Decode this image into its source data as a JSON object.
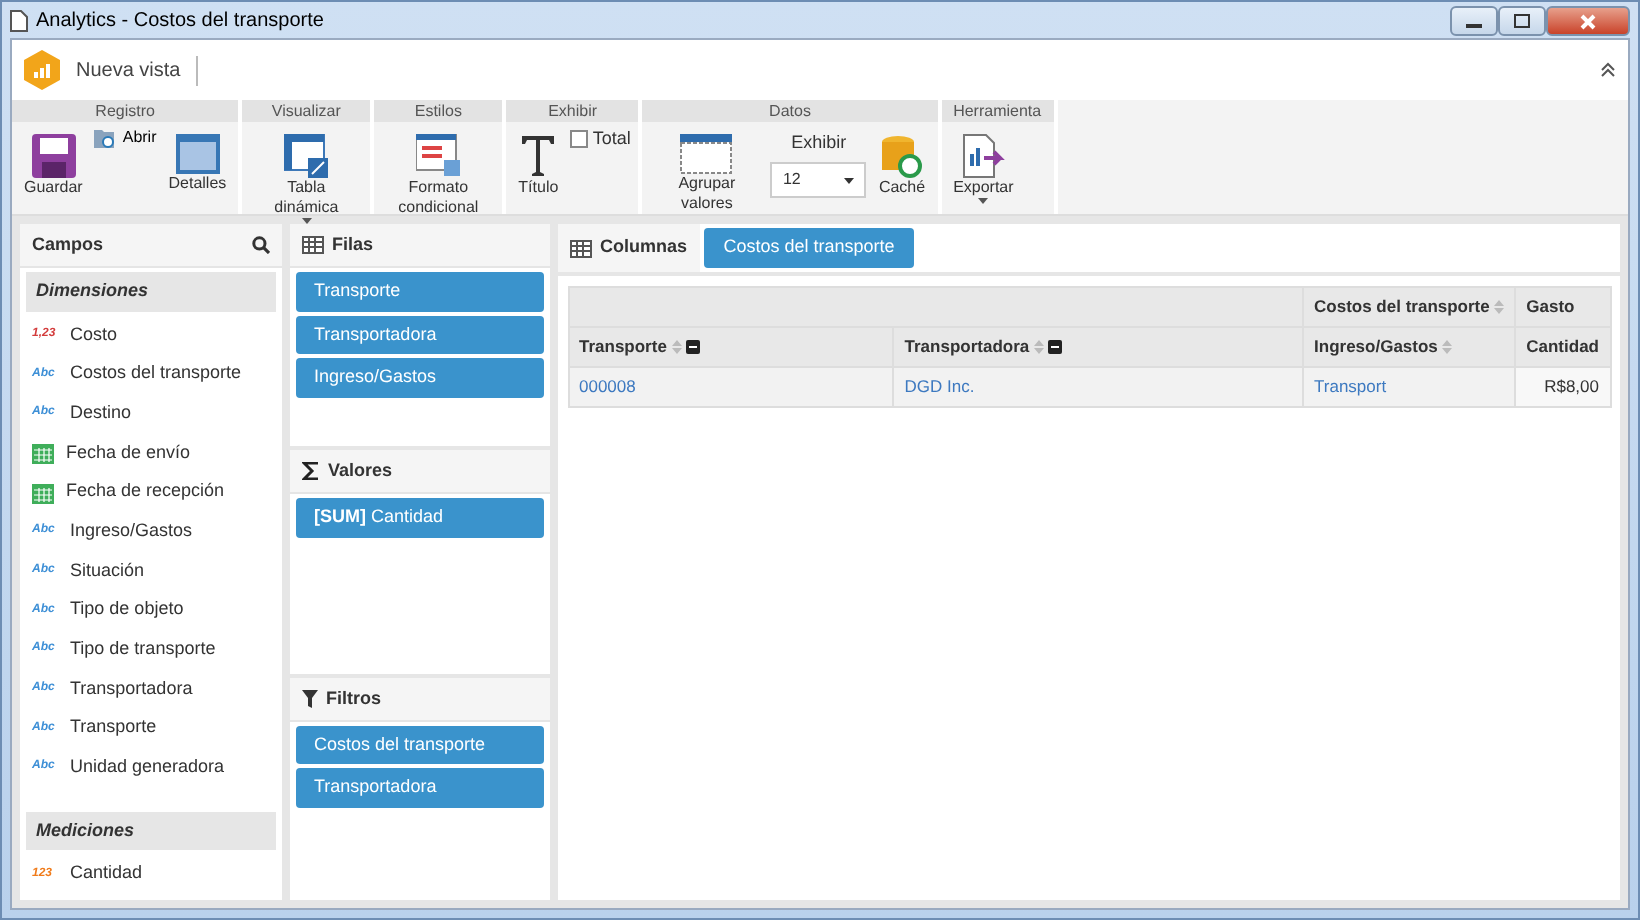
{
  "window": {
    "title": "Analytics - Costos del transporte"
  },
  "header": {
    "view_title": "Nueva vista"
  },
  "ribbon": [
    {
      "group": "Registro",
      "items": [
        {
          "kind": "big",
          "label": "Guardar"
        },
        {
          "kind": "small",
          "label": "Abrir"
        },
        {
          "kind": "big",
          "label": "Detalles"
        }
      ]
    },
    {
      "group": "Visualizar",
      "items": [
        {
          "kind": "big",
          "label": "Tabla dinámica",
          "dropdown": true
        }
      ]
    },
    {
      "group": "Estilos",
      "items": [
        {
          "kind": "big",
          "label": "Formato condicional"
        }
      ]
    },
    {
      "group": "Exhibir",
      "items": [
        {
          "kind": "big",
          "label": "Título"
        },
        {
          "kind": "check",
          "label": "Total",
          "checked": false
        }
      ]
    },
    {
      "group": "Datos",
      "items": [
        {
          "kind": "big",
          "label": "Agrupar valores"
        },
        {
          "kind": "select",
          "label": "Exhibir",
          "value": "12"
        },
        {
          "kind": "big",
          "label": "Caché"
        }
      ]
    },
    {
      "group": "Herramienta",
      "items": [
        {
          "kind": "big",
          "label": "Exportar",
          "dropdown": true
        }
      ]
    }
  ],
  "fields": {
    "title": "Campos",
    "sections": [
      {
        "title": "Dimensiones",
        "items": [
          {
            "kind": "number",
            "badge": "1,23",
            "label": "Costo"
          },
          {
            "kind": "text",
            "badge": "Abc",
            "label": "Costos del transporte"
          },
          {
            "kind": "text",
            "badge": "Abc",
            "label": "Destino"
          },
          {
            "kind": "date",
            "label": "Fecha de envío"
          },
          {
            "kind": "date",
            "label": "Fecha de recepción"
          },
          {
            "kind": "text",
            "badge": "Abc",
            "label": "Ingreso/Gastos"
          },
          {
            "kind": "text",
            "badge": "Abc",
            "label": "Situación"
          },
          {
            "kind": "text",
            "badge": "Abc",
            "label": "Tipo de objeto"
          },
          {
            "kind": "text",
            "badge": "Abc",
            "label": "Tipo de transporte"
          },
          {
            "kind": "text",
            "badge": "Abc",
            "label": "Transportadora"
          },
          {
            "kind": "text",
            "badge": "Abc",
            "label": "Transporte"
          },
          {
            "kind": "text",
            "badge": "Abc",
            "label": "Unidad generadora"
          }
        ]
      },
      {
        "title": "Mediciones",
        "items": [
          {
            "kind": "measure",
            "badge": "123",
            "label": "Cantidad"
          }
        ]
      }
    ]
  },
  "zones": [
    {
      "kind": "rows",
      "title": "Filas",
      "chips": [
        "Transporte",
        "Transportadora",
        "Ingreso/Gastos"
      ]
    },
    {
      "kind": "values",
      "title": "Valores",
      "chips": [
        "**[SUM]** Cantidad"
      ]
    },
    {
      "kind": "filters",
      "title": "Filtros",
      "chips": [
        "Costos del transporte",
        "Transportadora"
      ]
    }
  ],
  "columns_zone": {
    "title": "Columnas",
    "chips": [
      "Costos del transporte"
    ]
  },
  "table": {
    "top_headers": [
      {
        "sortable": false
      },
      {
        "label": "Costos del transporte",
        "sortable": true
      },
      {
        "label": "Gasto",
        "sortable": false
      }
    ],
    "columns": [
      {
        "label": "Transporte",
        "sortable": true,
        "collapsible": true
      },
      {
        "label": "Transportadora",
        "sortable": true,
        "collapsible": true
      },
      {
        "label": "Ingreso/Gastos",
        "sortable": true,
        "collapsible": false
      },
      {
        "label": "Cantidad",
        "sortable": false,
        "collapsible": false
      }
    ],
    "rows": [
      [
        "000008",
        "DGD Inc.",
        "Transport",
        "R$8,00"
      ]
    ]
  }
}
